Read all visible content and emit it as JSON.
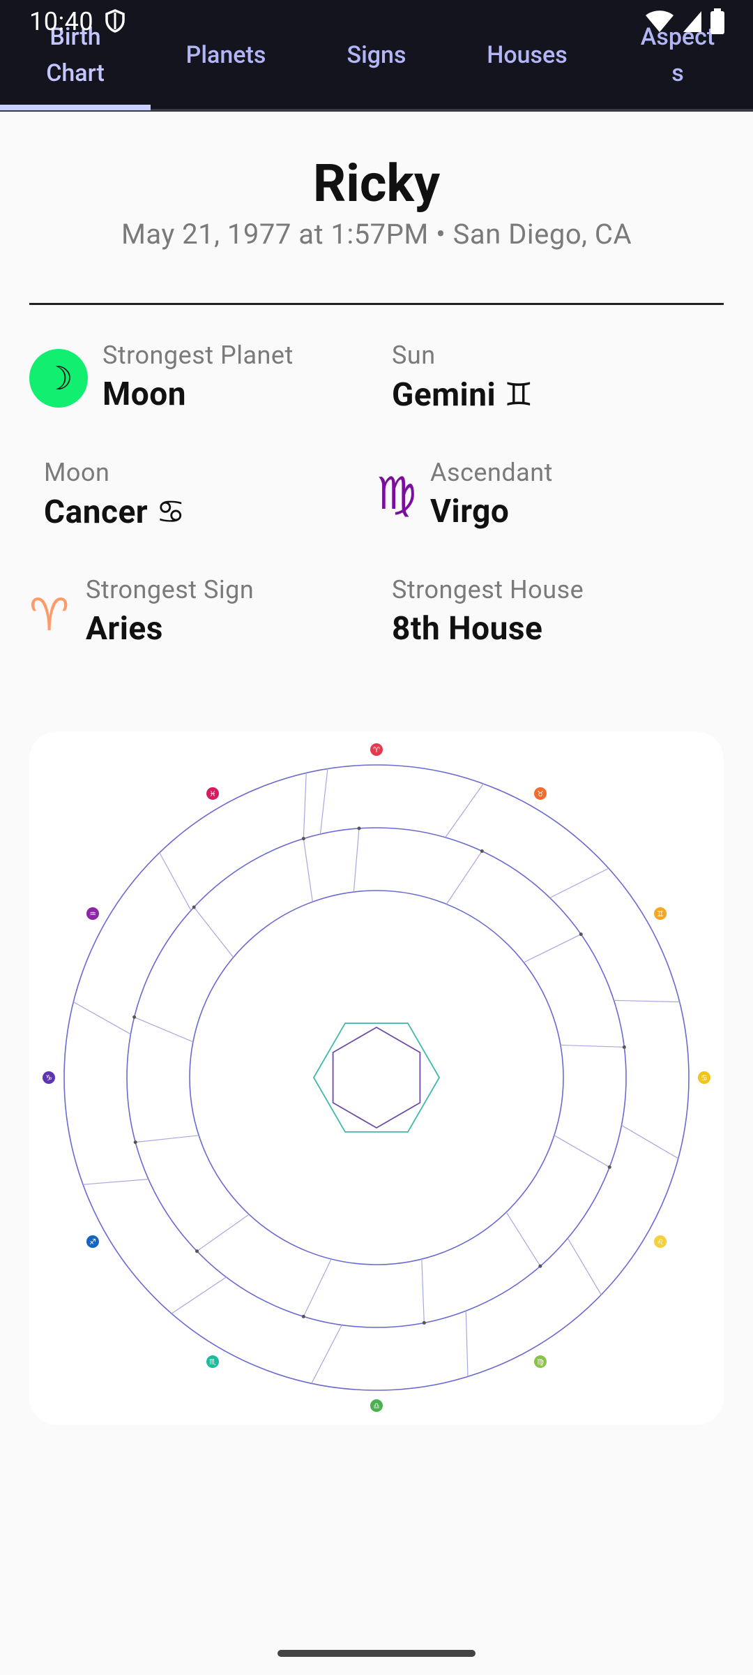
{
  "status_bar": {
    "time": "10:40"
  },
  "tabs": [
    {
      "label": "Birth\nChart",
      "active": true
    },
    {
      "label": "Planets",
      "active": false
    },
    {
      "label": "Signs",
      "active": false
    },
    {
      "label": "Houses",
      "active": false
    },
    {
      "label": "Aspect\ns",
      "active": false
    }
  ],
  "profile": {
    "name": "Ricky",
    "subtitle": "May 21, 1977 at 1:57PM • San Diego, CA"
  },
  "stats": {
    "strongest_planet": {
      "label": "Strongest Planet",
      "value": "Moon",
      "icon": "crescent-moon-icon",
      "badge_color": "#12ee6f"
    },
    "sun": {
      "label": "Sun",
      "value": "Gemini ♊"
    },
    "moon": {
      "label": "Moon",
      "value": "Cancer ♋"
    },
    "ascendant": {
      "label": "Ascendant",
      "value": "Virgo",
      "glyph": "♍",
      "glyph_color": "#7a0f9e"
    },
    "strongest_sign": {
      "label": "Strongest Sign",
      "value": "Aries",
      "glyph": "♈",
      "glyph_color": "#ff9a6b"
    },
    "strongest_house": {
      "label": "Strongest House",
      "value": "8th House"
    }
  },
  "chart": {
    "ring_color": "#6a6ad0",
    "zodiac_markers": [
      {
        "glyph": "♈",
        "color": "#e53950"
      },
      {
        "glyph": "♉",
        "color": "#f26d2d"
      },
      {
        "glyph": "♊",
        "color": "#f5a623"
      },
      {
        "glyph": "♋",
        "color": "#f0c419"
      },
      {
        "glyph": "♌",
        "color": "#f4d03f"
      },
      {
        "glyph": "♍",
        "color": "#8bc34a"
      },
      {
        "glyph": "♎",
        "color": "#4caf50"
      },
      {
        "glyph": "♏",
        "color": "#1abc9c"
      },
      {
        "glyph": "♐",
        "color": "#1565c0"
      },
      {
        "glyph": "♑",
        "color": "#5e35b1"
      },
      {
        "glyph": "♒",
        "color": "#8e24aa"
      },
      {
        "glyph": "♓",
        "color": "#d81b60"
      }
    ]
  }
}
